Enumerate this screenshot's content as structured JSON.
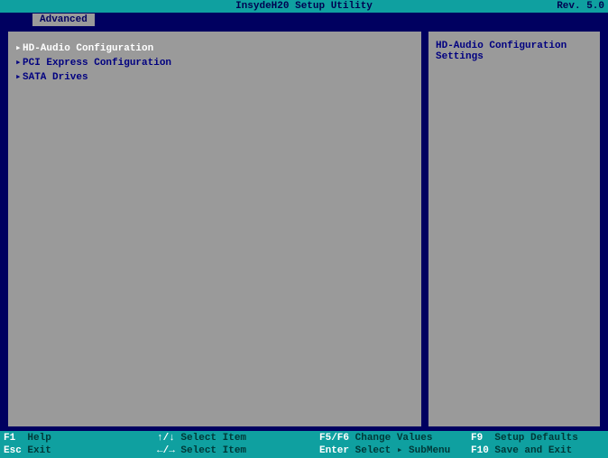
{
  "header": {
    "title": "InsydeH20 Setup Utility",
    "revision": "Rev. 5.0"
  },
  "tabs": {
    "active": "Advanced"
  },
  "menu": {
    "items": [
      {
        "label": "HD-Audio Configuration",
        "selected": true
      },
      {
        "label": "PCI Express Configuration",
        "selected": false
      },
      {
        "label": "SATA Drives",
        "selected": false
      }
    ]
  },
  "help_panel": {
    "text": "HD-Audio Configuration Settings"
  },
  "footer": {
    "col1": [
      {
        "key": "F1",
        "label": "Help"
      },
      {
        "key": "Esc",
        "label": "Exit"
      }
    ],
    "col2": [
      {
        "key": "↑/↓",
        "label": "Select Item"
      },
      {
        "key": "←/→",
        "label": "Select Item"
      }
    ],
    "col3": [
      {
        "key": "F5/F6",
        "label": "Change Values"
      },
      {
        "key": "Enter",
        "label": "Select ▸ SubMenu"
      }
    ],
    "col4": [
      {
        "key": "F9",
        "label": "Setup Defaults"
      },
      {
        "key": "F10",
        "label": "Save and Exit"
      }
    ]
  }
}
